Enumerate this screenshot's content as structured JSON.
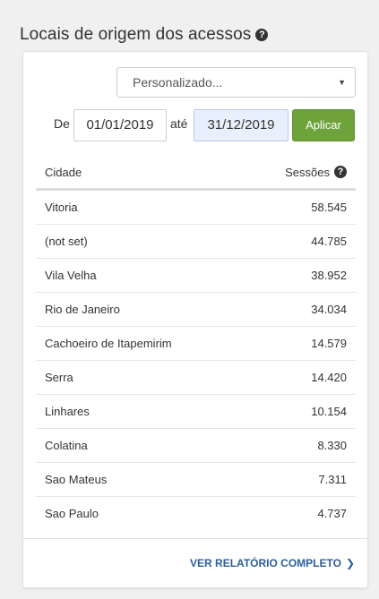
{
  "widget": {
    "title": "Locais de origem dos acessos",
    "help_icon": "?"
  },
  "filter": {
    "period_select": "Personalizado...",
    "caret": "▼",
    "from_label": "De",
    "from_date": "01/01/2019",
    "to_label": "até",
    "to_date": "31/12/2019",
    "apply_label": "Aplicar"
  },
  "table": {
    "col_city": "Cidade",
    "col_sessions": "Sessões",
    "rows": [
      {
        "city": "Vitoria",
        "sessions": "58.545"
      },
      {
        "city": "(not set)",
        "sessions": "44.785"
      },
      {
        "city": "Vila Velha",
        "sessions": "38.952"
      },
      {
        "city": "Rio de Janeiro",
        "sessions": "34.034"
      },
      {
        "city": "Cachoeiro de Itapemirim",
        "sessions": "14.579"
      },
      {
        "city": "Serra",
        "sessions": "14.420"
      },
      {
        "city": "Linhares",
        "sessions": "10.154"
      },
      {
        "city": "Colatina",
        "sessions": "8.330"
      },
      {
        "city": "Sao Mateus",
        "sessions": "7.311"
      },
      {
        "city": "Sao Paulo",
        "sessions": "4.737"
      }
    ]
  },
  "footer": {
    "link_label": "VER RELATÓRIO COMPLETO",
    "chevron": "❯"
  }
}
